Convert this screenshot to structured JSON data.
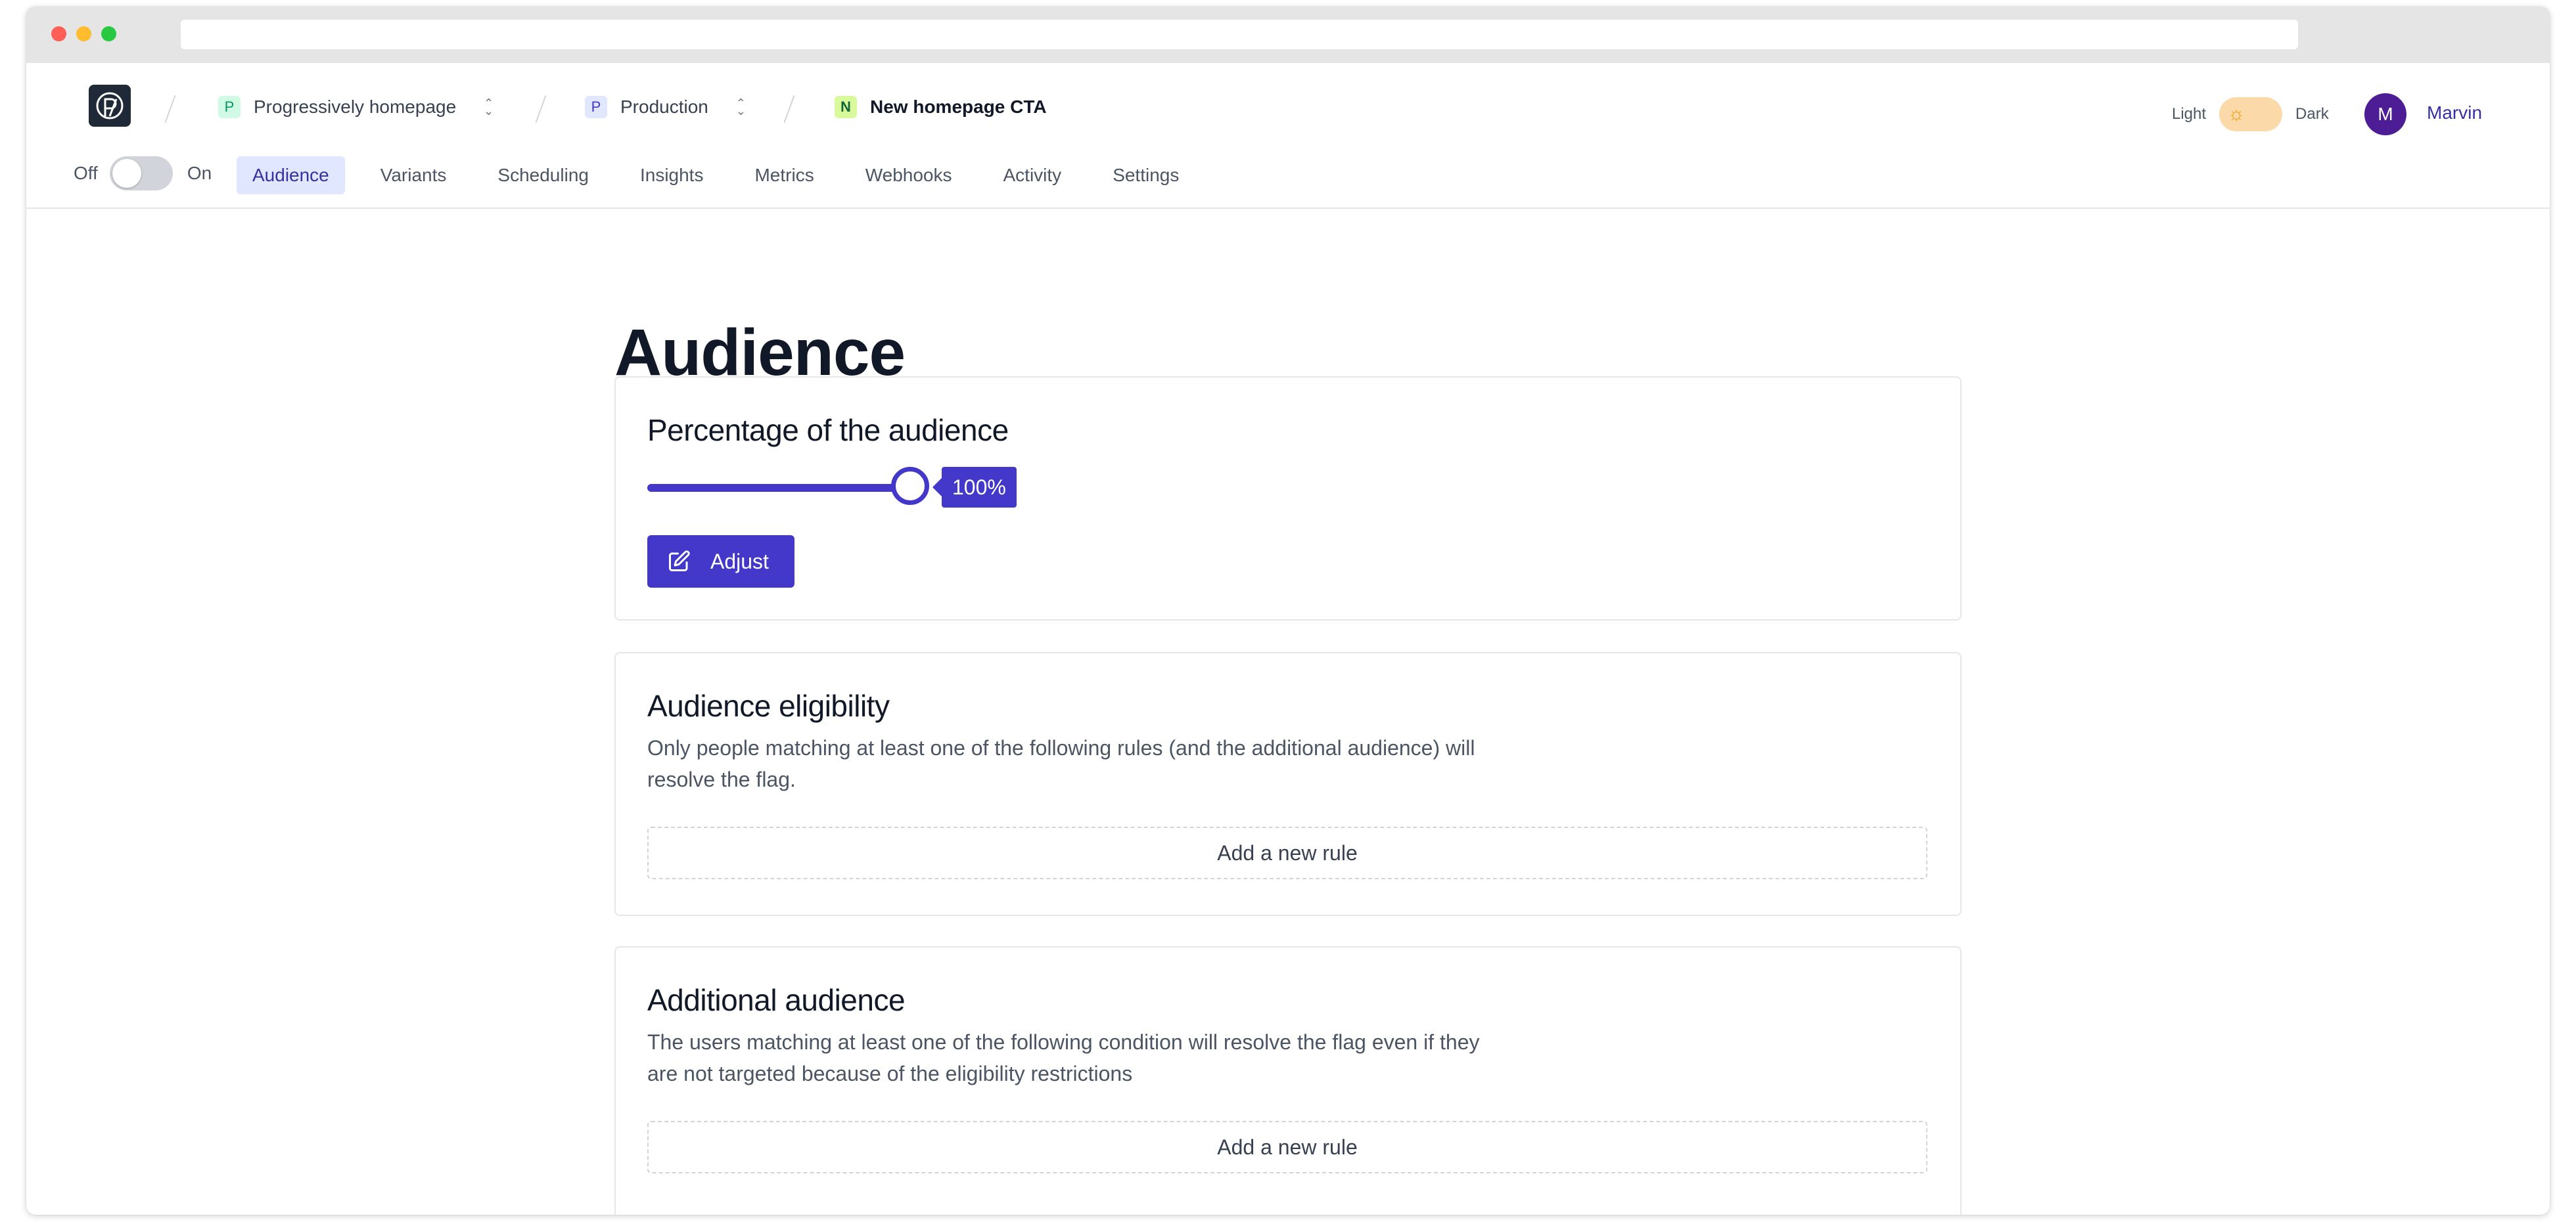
{
  "header": {
    "breadcrumbs": [
      {
        "badge": "P",
        "label": "Progressively homepage",
        "badge_color": "#d1fae5",
        "badge_text_color": "#059669"
      },
      {
        "badge": "P",
        "label": "Production",
        "badge_color": "#e0e7ff",
        "badge_text_color": "#4338ca"
      },
      {
        "badge": "N",
        "label": "New homepage CTA",
        "badge_color": "#d9f99d",
        "badge_text_color": "#166534"
      }
    ],
    "theme": {
      "light_label": "Light",
      "dark_label": "Dark"
    },
    "user": {
      "initial": "M",
      "name": "Marvin"
    }
  },
  "nav": {
    "switch": {
      "off_label": "Off",
      "on_label": "On"
    },
    "tabs": [
      {
        "label": "Audience",
        "active": true
      },
      {
        "label": "Variants"
      },
      {
        "label": "Scheduling"
      },
      {
        "label": "Insights"
      },
      {
        "label": "Metrics"
      },
      {
        "label": "Webhooks"
      },
      {
        "label": "Activity"
      },
      {
        "label": "Settings"
      }
    ]
  },
  "page": {
    "title": "Audience"
  },
  "percentage_card": {
    "title": "Percentage of the audience",
    "value": 100,
    "value_label": "100%",
    "adjust_label": "Adjust"
  },
  "eligibility_card": {
    "title": "Audience eligibility",
    "description": "Only people matching at least one of the following rules (and the additional audience) will resolve the flag.",
    "add_rule_label": "Add a new rule"
  },
  "additional_card": {
    "title": "Additional audience",
    "description": "The users matching at least one of the following condition will resolve the flag even if they are not targeted because of the eligibility restrictions",
    "add_rule_label": "Add a new rule"
  },
  "colors": {
    "accent": "#4338ca",
    "active_tab_bg": "#e0e7ff"
  }
}
